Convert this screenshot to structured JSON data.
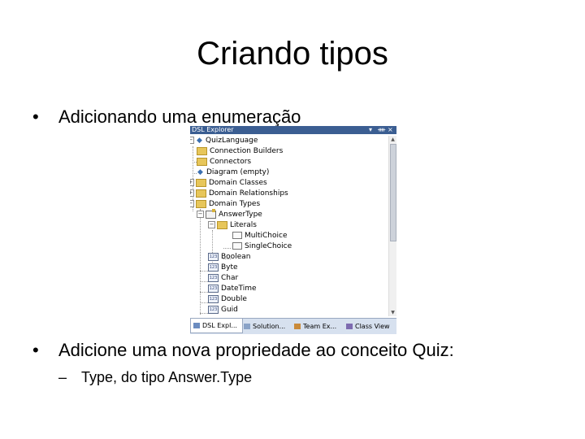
{
  "slide": {
    "title": "Criando tipos",
    "bullet1": "Adicionando uma enumeração",
    "bullet2": "Adicione uma nova propriedade ao conceito Quiz:",
    "sub1": "Type, do tipo Answer.Type",
    "bullet_glyph": "•",
    "dash_glyph": "–"
  },
  "panel": {
    "title": "DSL Explorer",
    "controls": [
      "▾",
      "ᚓ",
      "×"
    ],
    "tree": [
      {
        "label": "QuizLanguage",
        "icon": "diagram-icon"
      },
      {
        "label": "Connection Builders",
        "icon": "folder-icon"
      },
      {
        "label": "Connectors",
        "icon": "folder-icon"
      },
      {
        "label": "Diagram (empty)",
        "icon": "diagram-icon"
      },
      {
        "label": "Domain Classes",
        "icon": "folder-icon"
      },
      {
        "label": "Domain Relationships",
        "icon": "folder-icon"
      },
      {
        "label": "Domain Types",
        "icon": "folder-icon"
      },
      {
        "label": "AnswerType",
        "icon": "enum-icon"
      },
      {
        "label": "Literals",
        "icon": "folder-icon"
      },
      {
        "label": "MultiChoice",
        "icon": "literal-icon"
      },
      {
        "label": "SingleChoice",
        "icon": "literal-icon"
      },
      {
        "label": "Boolean",
        "icon": "type-icon"
      },
      {
        "label": "Byte",
        "icon": "type-icon"
      },
      {
        "label": "Char",
        "icon": "type-icon"
      },
      {
        "label": "DateTime",
        "icon": "type-icon"
      },
      {
        "label": "Double",
        "icon": "type-icon"
      },
      {
        "label": "Guid",
        "icon": "type-icon"
      }
    ],
    "type_badge": "123",
    "tabs": [
      {
        "label": "DSL Expl...",
        "active": true
      },
      {
        "label": "Solution...",
        "active": false
      },
      {
        "label": "Team Ex...",
        "active": false
      },
      {
        "label": "Class View",
        "active": false
      }
    ]
  },
  "colors": {
    "header": "#3b5e92",
    "folder": "#e7c65a",
    "tabstrip": "#d7e1ef"
  }
}
